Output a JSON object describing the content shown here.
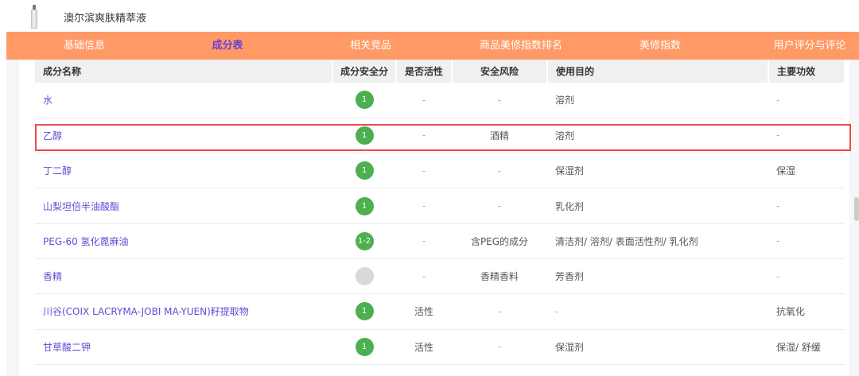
{
  "header": {
    "product_name": "澳尔滨爽肤精萃液",
    "thumbnail_icon": "product-bottle-icon"
  },
  "tabs": [
    {
      "label": "基础信息",
      "active": false
    },
    {
      "label": "成分表",
      "active": true
    },
    {
      "label": "相关竞品",
      "active": false
    },
    {
      "label": "商品美修指数排名",
      "active": false
    },
    {
      "label": "美修指数",
      "active": false
    },
    {
      "label": "用户评分与评论",
      "active": false
    }
  ],
  "colors": {
    "tab_bar": "#ff9a66",
    "active_tab": "#6a3fd6",
    "link": "#5b4fd3",
    "score_green": "#4caf50",
    "score_unknown": "#d9d9d9",
    "highlight": "#e94b4b"
  },
  "table": {
    "headers": {
      "name": "成分名称",
      "score": "成分安全分",
      "active": "是否活性",
      "risk": "安全风险",
      "purpose": "使用目的",
      "effect": "主要功效"
    },
    "rows": [
      {
        "name": "水",
        "score": "1",
        "score_color": "#4caf50",
        "active": "-",
        "risk": "-",
        "purpose": "溶剂",
        "effect": "-"
      },
      {
        "name": "乙醇",
        "score": "1",
        "score_color": "#4caf50",
        "active": "-",
        "risk": "酒精",
        "purpose": "溶剂",
        "effect": "-",
        "highlighted": true
      },
      {
        "name": "丁二醇",
        "score": "1",
        "score_color": "#4caf50",
        "active": "-",
        "risk": "-",
        "purpose": "保湿剂",
        "effect": "保湿"
      },
      {
        "name": "山梨坦倍半油酸酯",
        "score": "1",
        "score_color": "#4caf50",
        "active": "-",
        "risk": "-",
        "purpose": "乳化剂",
        "effect": "-"
      },
      {
        "name": "PEG-60 氢化蓖麻油",
        "score": "1-2",
        "score_color": "#4caf50",
        "active": "-",
        "risk": "含PEG的成分",
        "purpose": "清洁剂/ 溶剂/ 表面活性剂/ 乳化剂",
        "effect": "-"
      },
      {
        "name": "香精",
        "score": "",
        "score_color": "#d9d9d9",
        "active": "-",
        "risk": "香精香料",
        "purpose": "芳香剂",
        "effect": "-"
      },
      {
        "name": "川谷(COIX LACRYMA-JOBI MA-YUEN)籽提取物",
        "score": "1",
        "score_color": "#4caf50",
        "active": "活性",
        "risk": "-",
        "purpose": "-",
        "effect": "抗氧化"
      },
      {
        "name": "甘草酸二钾",
        "score": "1",
        "score_color": "#4caf50",
        "active": "活性",
        "risk": "-",
        "purpose": "保湿剂",
        "effect": "保湿/ 舒缓"
      }
    ]
  }
}
